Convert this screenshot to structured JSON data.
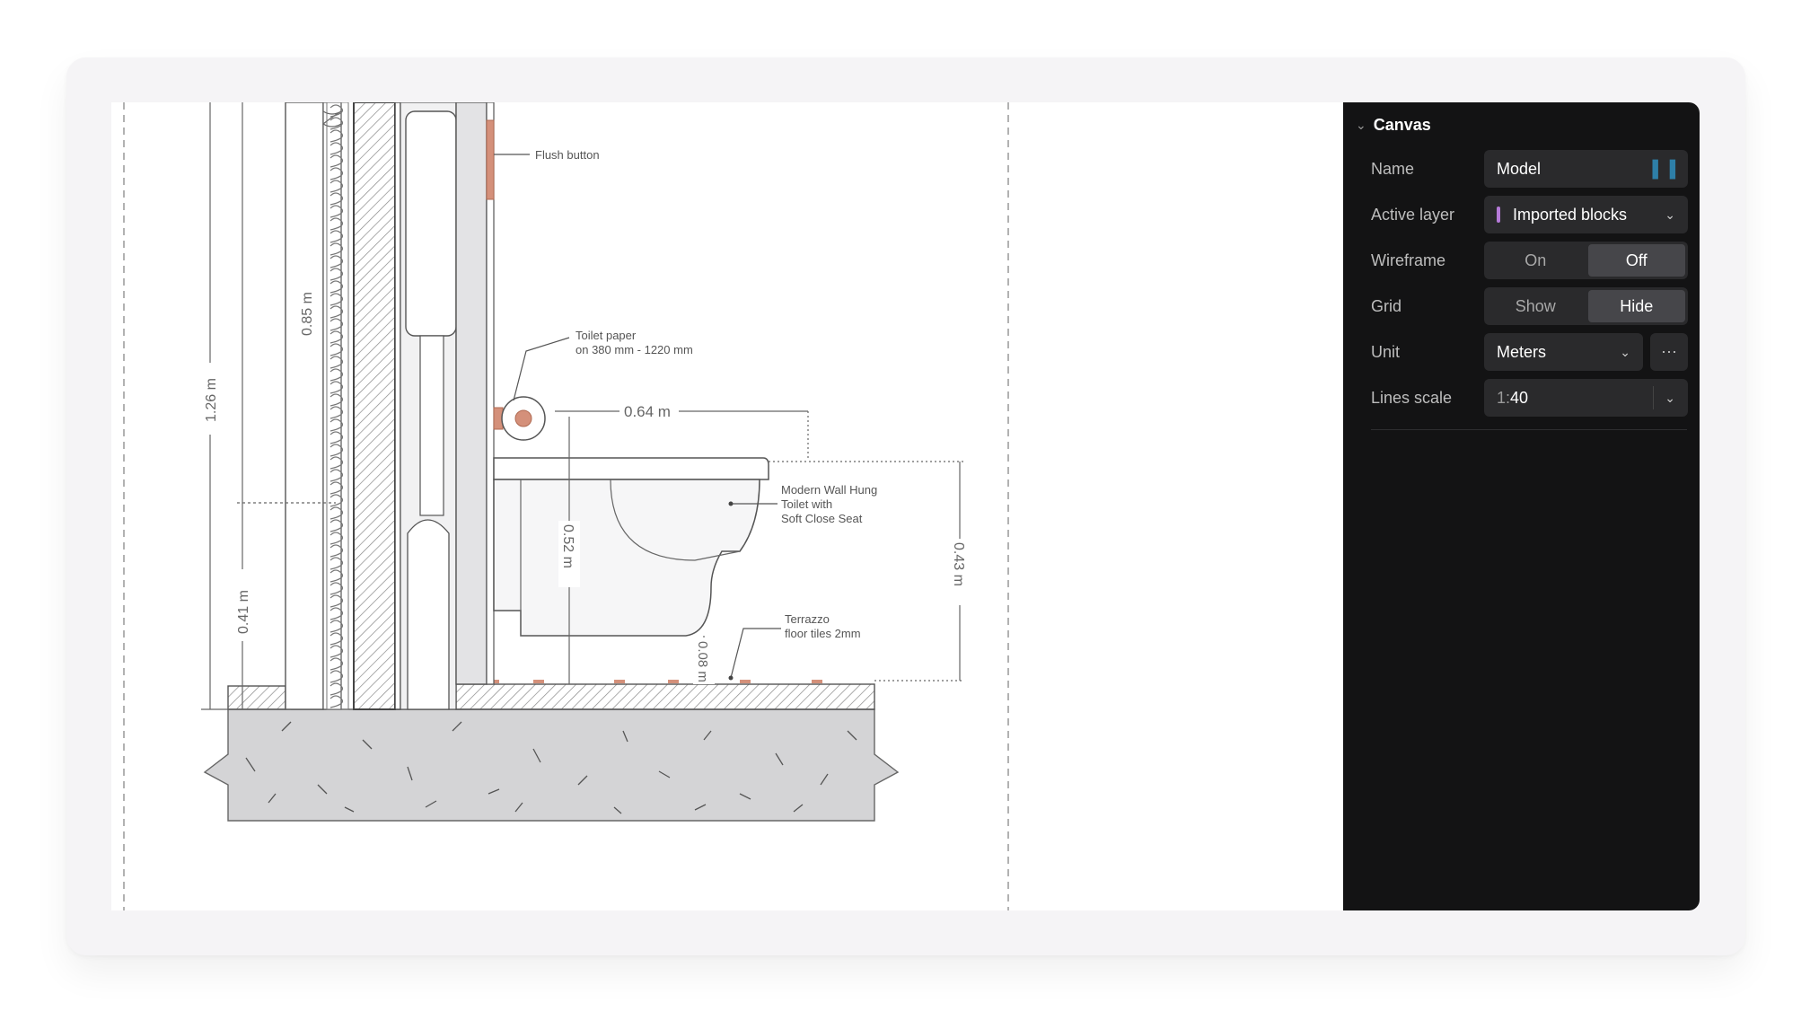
{
  "panel": {
    "section_title": "Canvas",
    "rows": {
      "name": {
        "label": "Name",
        "value": "Model"
      },
      "active_layer": {
        "label": "Active layer",
        "value": "Imported blocks",
        "swatch_color": "#b57ad8"
      },
      "wireframe": {
        "label": "Wireframe",
        "options": [
          "On",
          "Off"
        ],
        "selected": "Off"
      },
      "grid": {
        "label": "Grid",
        "options": [
          "Show",
          "Hide"
        ],
        "selected": "Hide"
      },
      "unit": {
        "label": "Unit",
        "value": "Meters"
      },
      "lines_scale": {
        "label": "Lines scale",
        "prefix": "1:",
        "value": "40"
      }
    }
  },
  "drawing": {
    "labels": {
      "flush_button": "Flush button",
      "toilet_paper_line1": "Toilet paper",
      "toilet_paper_line2": "on 380 mm - 1220 mm",
      "toilet_line1": "Modern Wall Hung",
      "toilet_line2": "Toilet with",
      "toilet_line3": "Soft Close Seat",
      "floor_line1": "Terrazzo",
      "floor_line2": "floor tiles 2mm"
    },
    "dimensions": {
      "d1": "0.85 m",
      "d2": "1.26 m",
      "d3": "0.41 m",
      "d4": "0.64 m",
      "d5": "0.52 m",
      "d6": "0.43 m",
      "d7": "0.08 m"
    }
  },
  "colors": {
    "panel_bg": "#131314",
    "field_bg": "#2a2a2c",
    "accent_copper": "#d4907a"
  }
}
